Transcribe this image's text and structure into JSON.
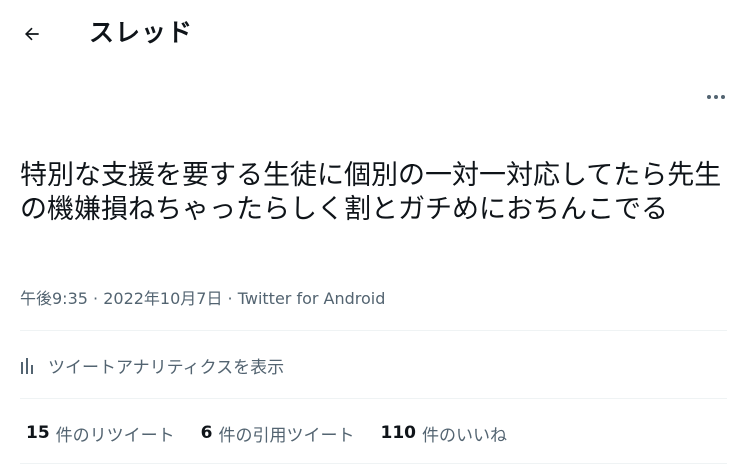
{
  "header": {
    "title": "スレッド",
    "back_icon": "arrow-left-icon"
  },
  "more_icon": "more-horizontal-icon",
  "tweet": {
    "text": "特別な支援を要する生徒に個別の一対一対応してたら先生の機嫌損ねちゃったらしく割とガチめにおちんこでる",
    "time": "午後9:35",
    "separator1": " · ",
    "date": "2022年10月7日",
    "separator2": " · ",
    "source": "Twitter for Android"
  },
  "analytics": {
    "icon": "bar-chart-icon",
    "label": "ツイートアナリティクスを表示"
  },
  "stats": {
    "retweets": {
      "count": "15",
      "label": "件のリツイート"
    },
    "quotes": {
      "count": "6",
      "label": "件の引用ツイート"
    },
    "likes": {
      "count": "110",
      "label": "件のいいね"
    }
  },
  "colors": {
    "text": "#0f1419",
    "secondary": "#536471",
    "divider": "#eff3f4"
  }
}
